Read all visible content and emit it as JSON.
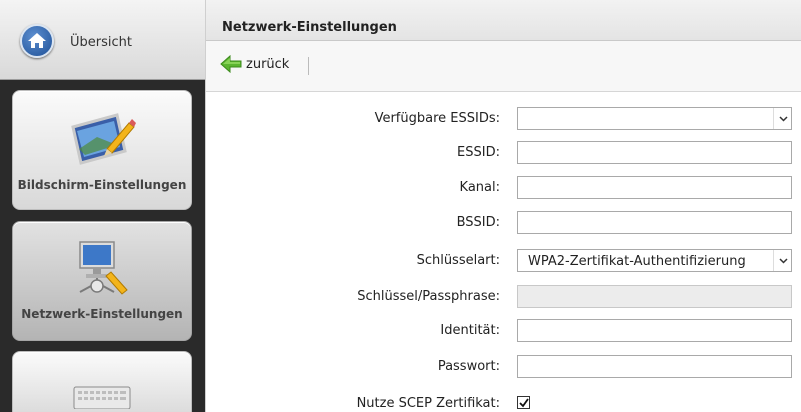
{
  "sidebar": {
    "home_label": "Übersicht",
    "tiles": [
      {
        "label": "Bildschirm-Einstellungen",
        "icon": "monitor-pen-icon"
      },
      {
        "label": "Netzwerk-Einstellungen",
        "icon": "network-monitor-icon",
        "active": true
      },
      {
        "label": "",
        "icon": "keyboard-icon"
      }
    ]
  },
  "header": {
    "title": "Netzwerk-Einstellungen"
  },
  "toolbar": {
    "back_label": "zurück",
    "back_icon": "green-arrow-left-icon"
  },
  "form": {
    "essids_label": "Verfügbare ESSIDs:",
    "essids_value": "",
    "essid_label": "ESSID:",
    "essid_value": "",
    "channel_label": "Kanal:",
    "channel_value": "",
    "bssid_label": "BSSID:",
    "bssid_value": "",
    "keytype_label": "Schlüsselart:",
    "keytype_value": "WPA2-Zertifikat-Authentifizierung",
    "passphrase_label": "Schlüssel/Passphrase:",
    "passphrase_value": "",
    "identity_label": "Identität:",
    "identity_value": "",
    "password_label": "Passwort:",
    "password_value": "",
    "scep_label": "Nutze SCEP Zertifikat:",
    "scep_checked": true
  },
  "colors": {
    "sidebar_bg": "#2a2a2a",
    "home_blue": "#1d4f96",
    "back_green": "#5cb531"
  }
}
